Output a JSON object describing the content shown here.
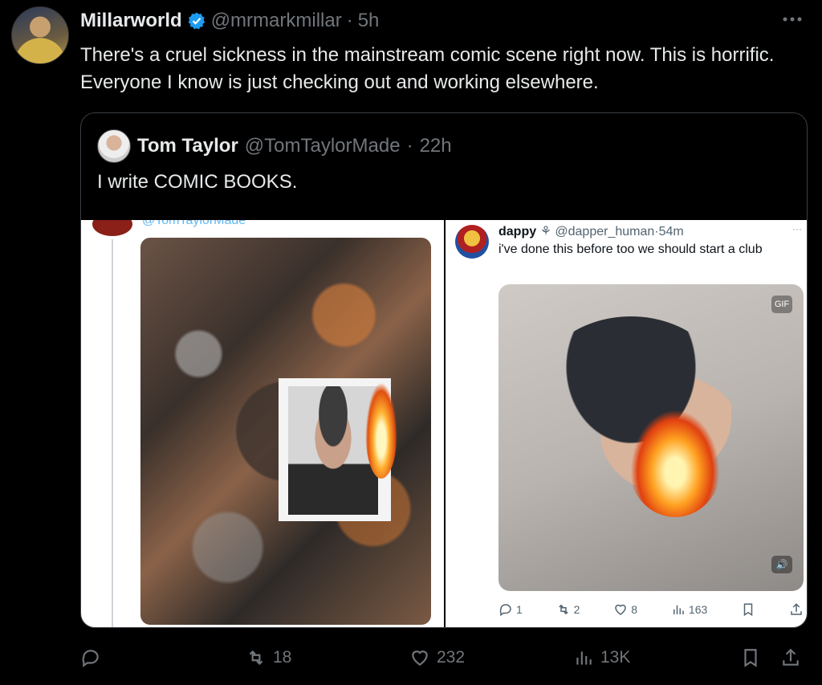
{
  "tweet": {
    "display_name": "Millarworld",
    "handle": "@mrmarkmillar",
    "separator": "·",
    "time": "5h",
    "text": "There's a cruel sickness in the mainstream comic scene right now. This is horrific. Everyone I know is just checking out and working elsewhere.",
    "verified_icon": "verified-badge-icon",
    "more_icon": "more-horizontal-icon"
  },
  "quote": {
    "display_name": "Tom Taylor",
    "handle": "@TomTaylorMade",
    "separator": "·",
    "time": "22h",
    "text": "I write COMIC BOOKS."
  },
  "media_left": {
    "handle_fragment": "@TomTaylorMade"
  },
  "media_right": {
    "name": "dappy",
    "name_symbol": "⚘",
    "handle": "@dapper_human",
    "separator": "·",
    "time": "54m",
    "more": "···",
    "text": "i've done this before too we should start a club",
    "gif_label": "GIF",
    "replies": "1",
    "reposts": "2",
    "likes": "8",
    "views": "163"
  },
  "actions": {
    "replies": "",
    "reposts": "18",
    "likes": "232",
    "views": "13K"
  },
  "colors": {
    "background": "#000000",
    "text": "#e7e9ea",
    "muted": "#71767b",
    "verified": "#1d9bf0"
  }
}
